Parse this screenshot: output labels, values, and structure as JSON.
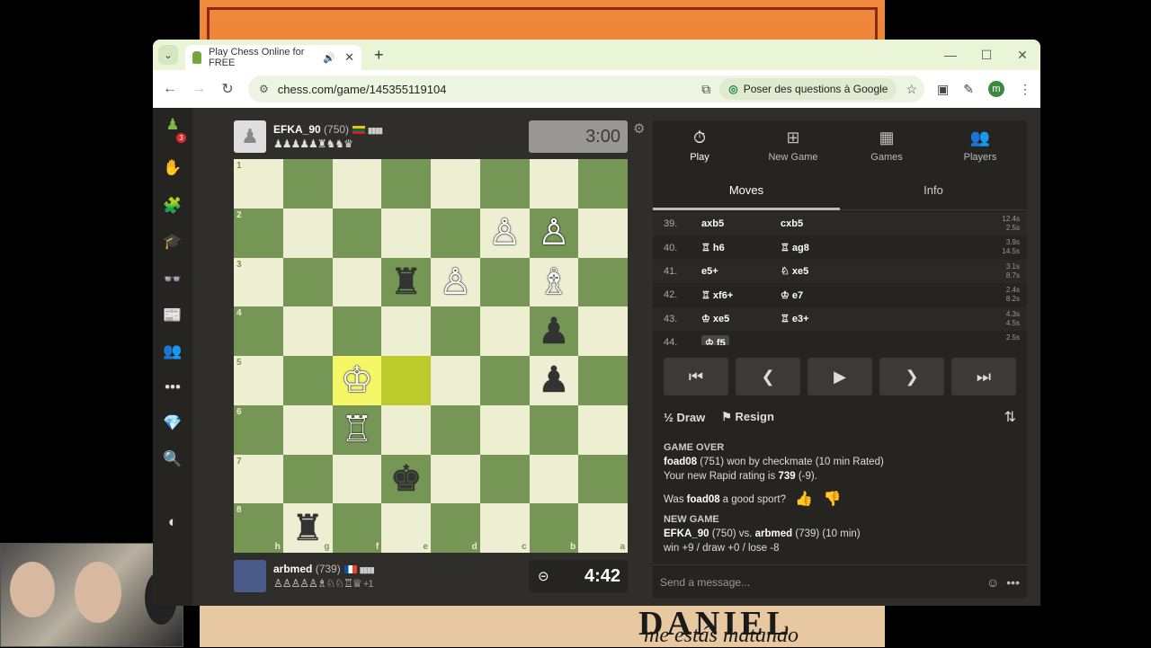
{
  "browser": {
    "tab_title": "Play Chess Online for FREE",
    "url": "chess.com/game/145355119104",
    "google_btn": "Poser des questions à Google",
    "profile_initial": "m"
  },
  "sidebar": {
    "badge": "3"
  },
  "top_player": {
    "name": "EFKA_90",
    "rating": "(750)",
    "captures": "♟♟♟♟♟♜♞♞♛",
    "clock": "3:00"
  },
  "bottom_player": {
    "name": "arbmed",
    "rating": "(739)",
    "captures": "♙♙♙♙♙♗♘♘♖♕",
    "advantage": "+1",
    "clock": "4:42"
  },
  "board": {
    "ranks": [
      "1",
      "2",
      "3",
      "4",
      "5",
      "6",
      "7",
      "8"
    ],
    "files": [
      "h",
      "g",
      "f",
      "e",
      "d",
      "c",
      "b",
      "a"
    ],
    "pieces": [
      {
        "sq": "c2",
        "p": "♙",
        "c": "w"
      },
      {
        "sq": "b2",
        "p": "♙",
        "c": "w"
      },
      {
        "sq": "e3",
        "p": "♜",
        "c": "b"
      },
      {
        "sq": "d3",
        "p": "♙",
        "c": "w"
      },
      {
        "sq": "b3",
        "p": "♗",
        "c": "w"
      },
      {
        "sq": "b4",
        "p": "♟",
        "c": "b"
      },
      {
        "sq": "f5",
        "p": "♔",
        "c": "w"
      },
      {
        "sq": "b5",
        "p": "♟",
        "c": "b"
      },
      {
        "sq": "f6",
        "p": "♖",
        "c": "w"
      },
      {
        "sq": "e7",
        "p": "♚",
        "c": "b"
      },
      {
        "sq": "g8",
        "p": "♜",
        "c": "b"
      }
    ],
    "highlights": {
      "f5": "hl",
      "e5": "hl2"
    }
  },
  "panel": {
    "tabs": [
      {
        "icon": "⏱",
        "label": "Play"
      },
      {
        "icon": "⊞",
        "label": "New Game"
      },
      {
        "icon": "▦",
        "label": "Games"
      },
      {
        "icon": "👥",
        "label": "Players"
      }
    ],
    "subtabs": [
      "Moves",
      "Info"
    ],
    "moves": [
      {
        "n": "39.",
        "w": "axb5",
        "b": "cxb5",
        "t": "12.4s\n2.5s"
      },
      {
        "n": "40.",
        "w": "♖ h6",
        "b": "♖ ag8",
        "t": "3.9s\n14.5s"
      },
      {
        "n": "41.",
        "w": "e5+",
        "b": "♘ xe5",
        "t": "3.1s\n8.7s"
      },
      {
        "n": "42.",
        "w": "♖ xf6+",
        "b": "♔ e7",
        "t": "2.4s\n8.2s"
      },
      {
        "n": "43.",
        "w": "♔ xe5",
        "b": "♖ e3+",
        "t": "4.3s\n4.5s"
      },
      {
        "n": "44.",
        "w": "♔ f5",
        "b": "",
        "t": "2.5s"
      }
    ],
    "draw": "Draw",
    "resign": "Resign",
    "log": {
      "over_title": "GAME OVER",
      "winner": "foad08",
      "winner_rest": " (751) won by checkmate (10 min Rated)",
      "rating_line": "Your new Rapid rating is ",
      "rating_val": "739",
      "rating_delta": " (-9).",
      "sport_q1": "Was ",
      "sport_name": "foad08",
      "sport_q2": " a good sport?",
      "new_title": "NEW GAME",
      "p1": "EFKA_90",
      "p1r": " (750) vs. ",
      "p2": "arbmed",
      "p2r": " (739) (10 min)",
      "record": "win +9 / draw +0 / lose -8"
    },
    "chat_placeholder": "Send a message..."
  },
  "background": {
    "word1": "DANIEL",
    "word2": "me estás matando"
  }
}
